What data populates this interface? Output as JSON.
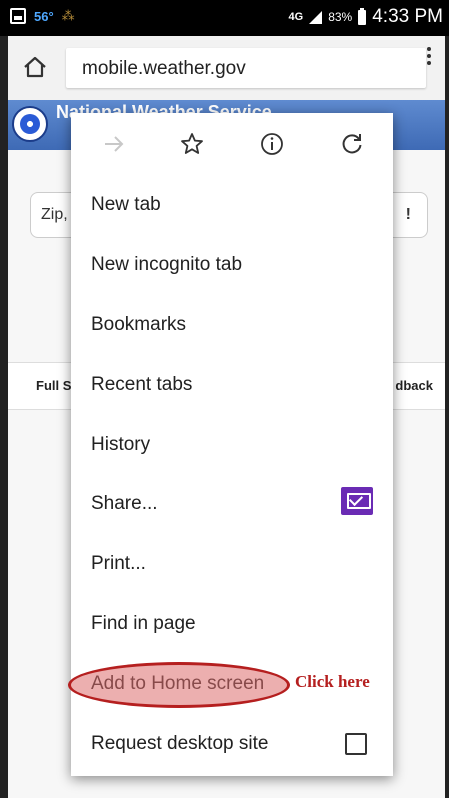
{
  "status_bar": {
    "temperature": "56°",
    "network": "4G",
    "battery_percent": "83%",
    "time": "4:33 PM"
  },
  "browser": {
    "url": "mobile.weather.gov"
  },
  "page": {
    "header_title": "National Weather Service",
    "zip_placeholder": "Zip,",
    "go_label": "!",
    "nav_left": "Full S",
    "nav_right": "dback"
  },
  "menu": {
    "items": [
      {
        "label": "New tab"
      },
      {
        "label": "New incognito tab"
      },
      {
        "label": "Bookmarks"
      },
      {
        "label": "Recent tabs"
      },
      {
        "label": "History"
      },
      {
        "label": "Share..."
      },
      {
        "label": "Print..."
      },
      {
        "label": "Find in page"
      },
      {
        "label": "Add to Home screen"
      },
      {
        "label": "Request desktop site"
      }
    ]
  },
  "annotation": {
    "text": "Click here",
    "color": "#b51f1f"
  }
}
